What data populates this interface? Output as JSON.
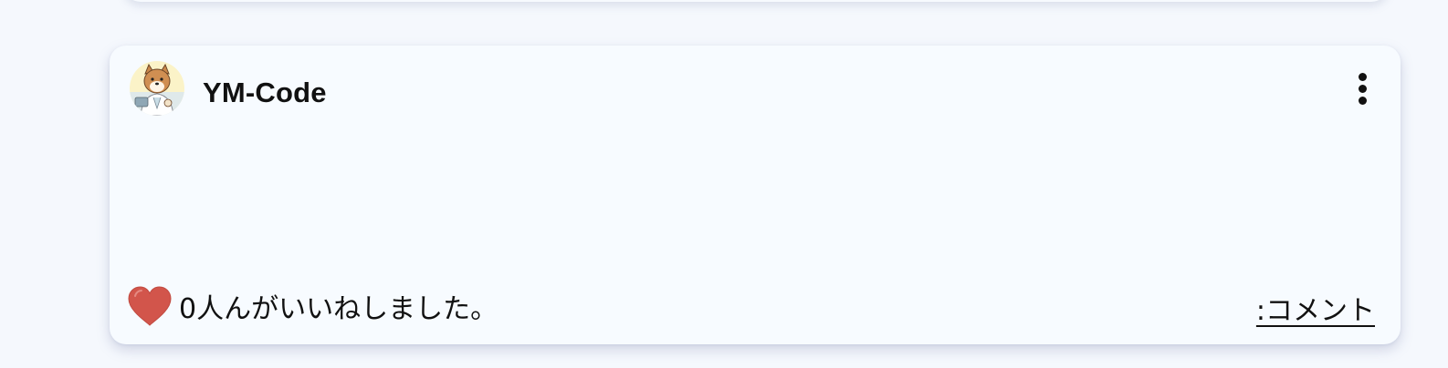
{
  "post": {
    "author": "YM-Code",
    "avatar_icon": "shiba-dog-avatar",
    "menu_icon": "more-vertical-icon",
    "likes": {
      "icon": "heart-icon",
      "color": "#d2554b",
      "text": "0人んがいいねしました。"
    },
    "comment_link": ":コメント"
  }
}
